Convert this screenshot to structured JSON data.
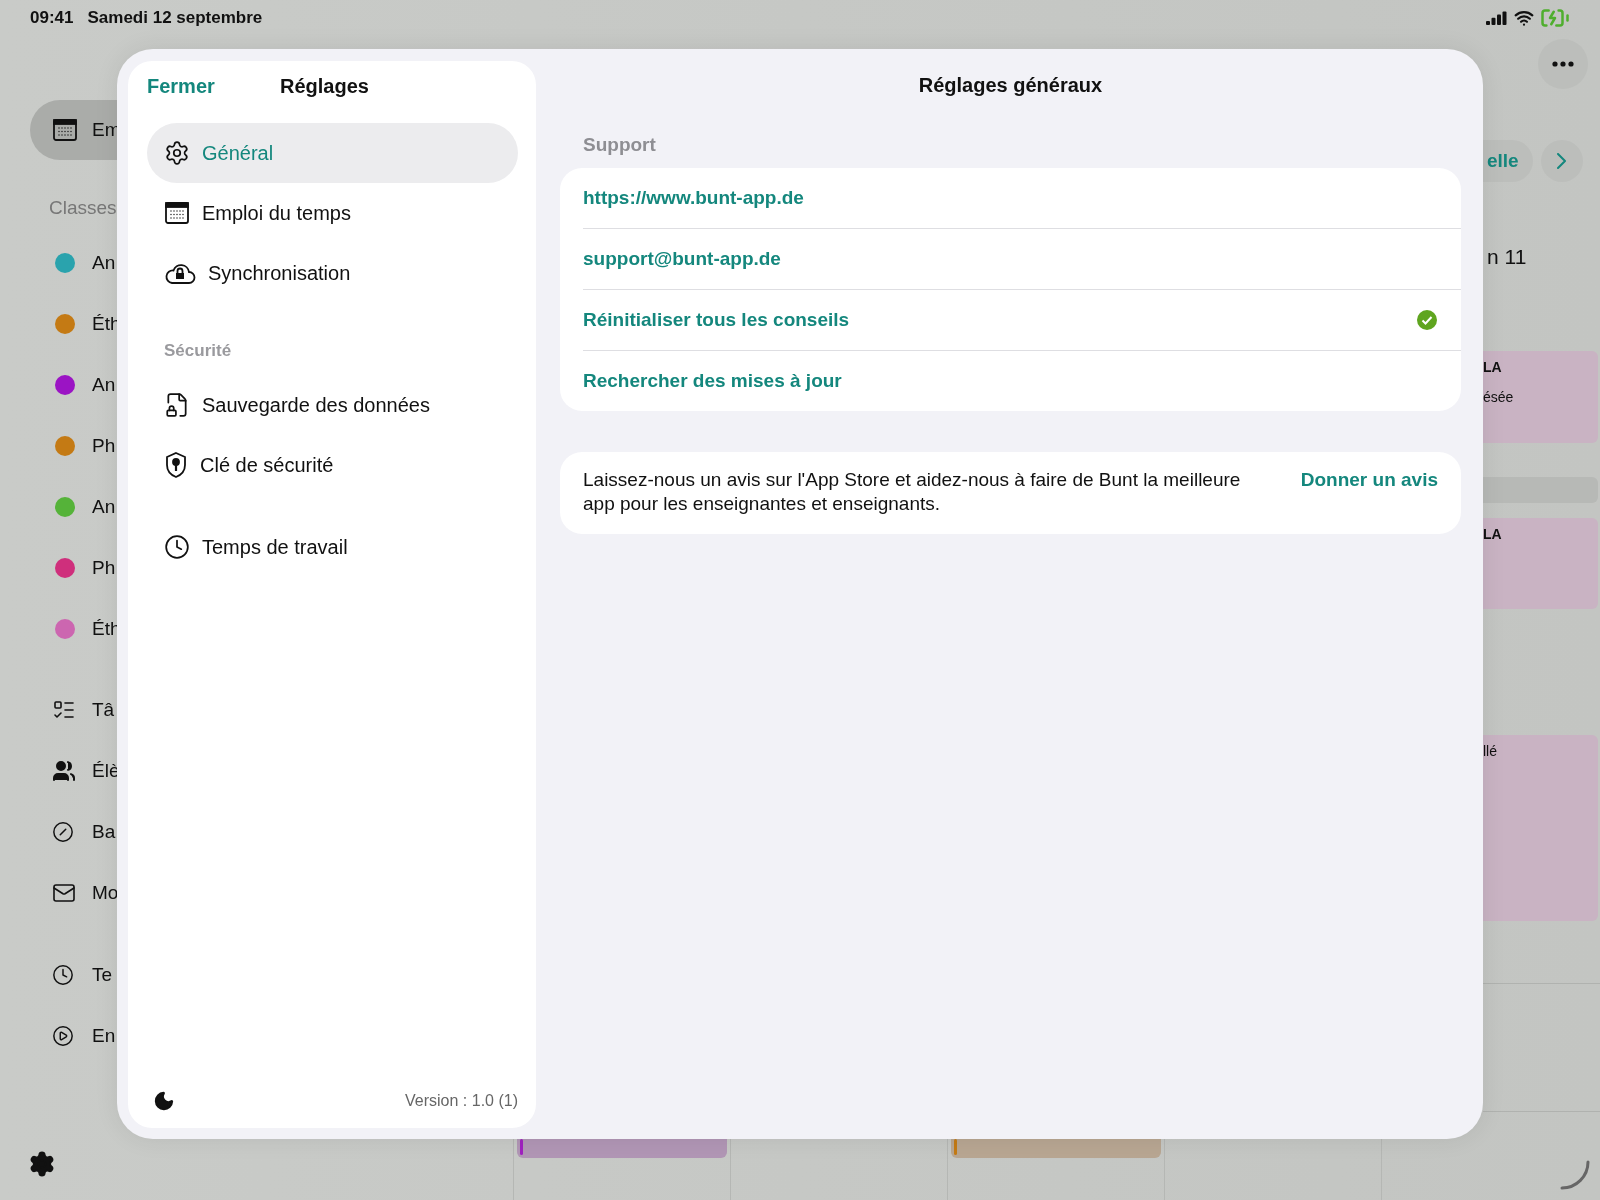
{
  "status_bar": {
    "time": "09:41",
    "date": "Samedi 12 septembre"
  },
  "background": {
    "sidebar": {
      "top_items": [
        {
          "label": "Em",
          "selected": true
        }
      ],
      "section": "Classes",
      "classes": [
        {
          "label": "An",
          "color": "#2aa3ad"
        },
        {
          "label": "Éth",
          "color": "#c47a14"
        },
        {
          "label": "An",
          "color": "#9b14c4"
        },
        {
          "label": "Ph",
          "color": "#c47a14"
        },
        {
          "label": "An",
          "color": "#55b339"
        },
        {
          "label": "Ph",
          "color": "#cf2f7c"
        },
        {
          "label": "Éth",
          "color": "#cc66b0"
        }
      ],
      "tools": [
        {
          "label": "Tâ"
        },
        {
          "label": "Élè"
        },
        {
          "label": "Ba"
        },
        {
          "label": "Mo"
        }
      ],
      "extras": [
        {
          "label": "Te"
        },
        {
          "label": "En"
        }
      ]
    },
    "toolbar": {
      "today_button": "elle",
      "week_label": "n 11"
    },
    "events": [
      {
        "lines": [
          "LA",
          "ésée"
        ]
      },
      {
        "lines": [
          "LA"
        ]
      },
      {
        "lines": [
          "llé"
        ]
      }
    ],
    "bottom_events": [
      {
        "color": "#a020c0"
      },
      {
        "color": "#c47a14"
      }
    ]
  },
  "settings": {
    "close": "Fermer",
    "title": "Réglages",
    "groups": [
      {
        "items": [
          {
            "label": "Général",
            "selected": true
          },
          {
            "label": "Emploi du temps",
            "selected": false
          },
          {
            "label": "Synchronisation",
            "selected": false
          }
        ]
      },
      {
        "header": "Sécurité",
        "items": [
          {
            "label": "Sauvegarde des données",
            "selected": false
          },
          {
            "label": "Clé de sécurité",
            "selected": false
          }
        ]
      },
      {
        "items": [
          {
            "label": "Temps de travail",
            "selected": false
          }
        ]
      }
    ],
    "version": "Version : 1.0 (1)",
    "detail_title": "Réglages généraux",
    "support": {
      "header": "Support",
      "rows": [
        {
          "label": "https://www.bunt-app.de",
          "done": false
        },
        {
          "label": "support@bunt-app.de",
          "done": false
        },
        {
          "label": "Réinitialiser tous les conseils",
          "done": true
        },
        {
          "label": "Rechercher des mises à jour",
          "done": false
        }
      ]
    },
    "review": {
      "text": "Laissez-nous un avis sur l'App Store et aidez-nous à faire de Bunt la meilleure app pour les enseignantes et enseignants.",
      "action": "Donner un avis"
    }
  }
}
